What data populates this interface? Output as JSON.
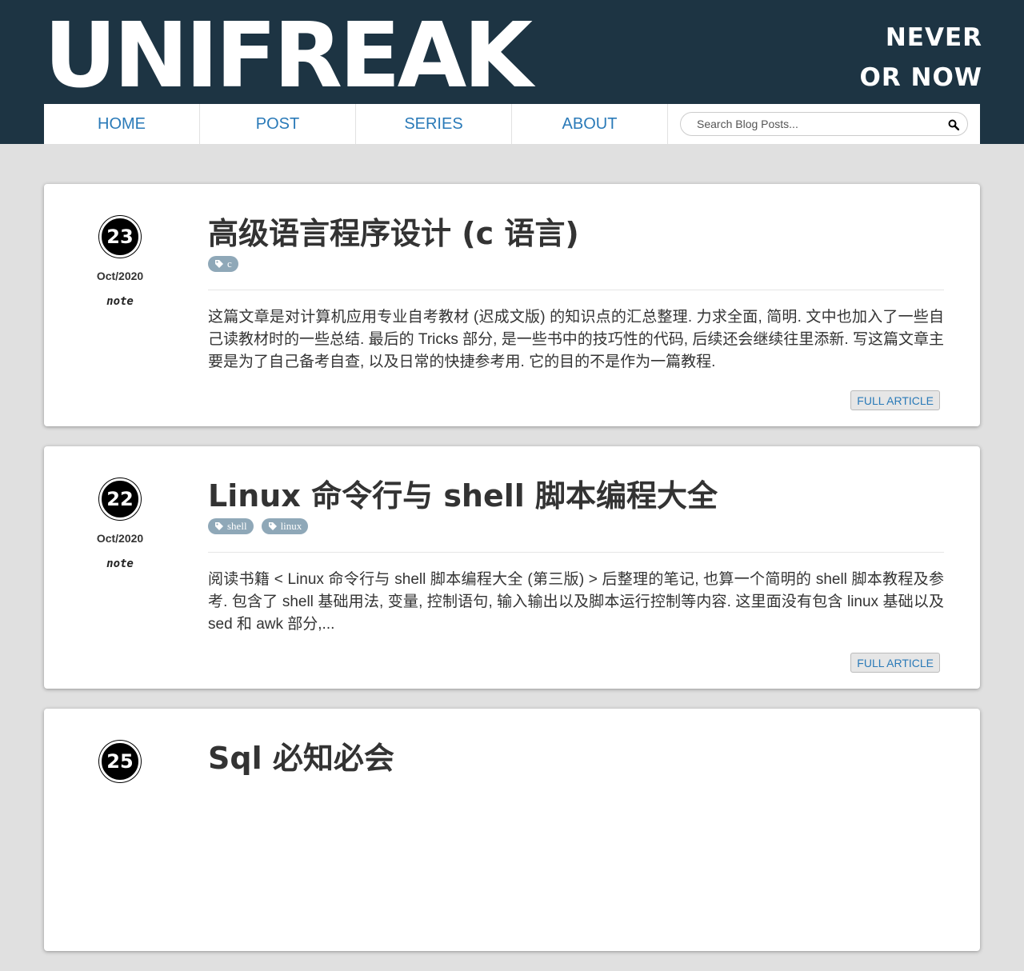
{
  "header": {
    "logo": "UNIFREAK",
    "slogan_line1": "NEVER",
    "slogan_line2": "OR NOW"
  },
  "nav": {
    "home": "HOME",
    "post": "POST",
    "series": "SERIES",
    "about": "ABOUT",
    "search_placeholder": "Search Blog Posts..."
  },
  "posts": [
    {
      "day": "23",
      "month": "Oct/2020",
      "category": "note",
      "title": "高级语言程序设计 (c 语言)",
      "tags": [
        "c"
      ],
      "excerpt": "这篇文章是对计算机应用专业自考教材 (迟成文版) 的知识点的汇总整理. 力求全面, 简明. 文中也加入了一些自己读教材时的一些总结. 最后的 Tricks 部分, 是一些书中的技巧性的代码, 后续还会继续往里添新. 写这篇文章主要是为了自己备考自查, 以及日常的快捷参考用. 它的目的不是作为一篇教程.",
      "more": "FULL ARTICLE"
    },
    {
      "day": "22",
      "month": "Oct/2020",
      "category": "note",
      "title": "Linux 命令行与 shell 脚本编程大全",
      "tags": [
        "shell",
        "linux"
      ],
      "excerpt": "阅读书籍 < Linux 命令行与 shell 脚本编程大全 (第三版) > 后整理的笔记, 也算一个简明的 shell 脚本教程及参考. 包含了 shell 基础用法, 变量, 控制语句, 输入输出以及脚本运行控制等内容. 这里面没有包含 linux 基础以及 sed 和 awk 部分,...",
      "more": "FULL ARTICLE"
    },
    {
      "day": "25",
      "title": "Sql 必知必会"
    }
  ],
  "colors": {
    "header_bg": "#1d3443",
    "link": "#2a7ab8",
    "tag_bg": "#8fa8b8",
    "page_bg": "#e0e0e0"
  }
}
